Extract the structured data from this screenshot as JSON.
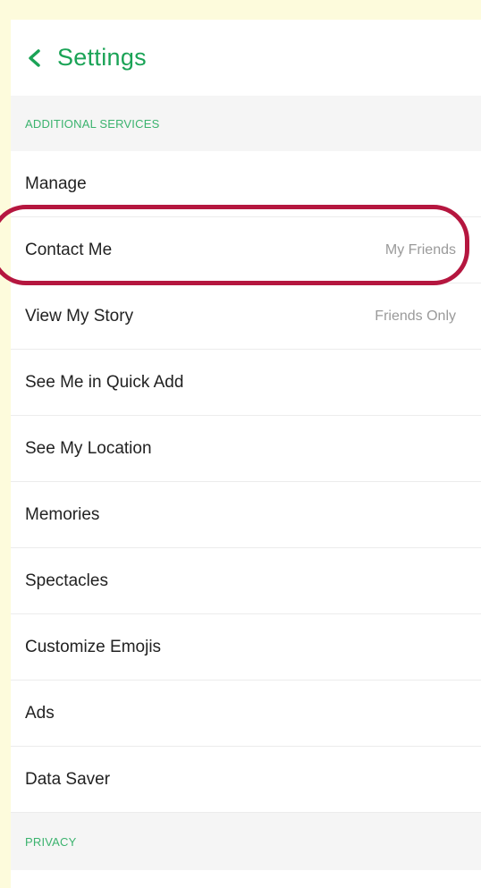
{
  "header": {
    "title": "Settings",
    "back_icon": "chevron-left-icon"
  },
  "sections": {
    "additional_services": {
      "label": "ADDITIONAL SERVICES",
      "items": [
        {
          "label": "Manage",
          "value": ""
        },
        {
          "label": "Contact Me",
          "value": "My Friends"
        },
        {
          "label": "View My Story",
          "value": "Friends Only"
        },
        {
          "label": "See Me in Quick Add",
          "value": ""
        },
        {
          "label": "See My Location",
          "value": ""
        },
        {
          "label": "Memories",
          "value": ""
        },
        {
          "label": "Spectacles",
          "value": ""
        },
        {
          "label": "Customize Emojis",
          "value": ""
        },
        {
          "label": "Ads",
          "value": ""
        },
        {
          "label": "Data Saver",
          "value": ""
        }
      ]
    },
    "privacy": {
      "label": "PRIVACY"
    }
  },
  "colors": {
    "accent_green": "#1aa356",
    "highlight_red": "#b5163f",
    "page_background": "#fdfbdc"
  }
}
